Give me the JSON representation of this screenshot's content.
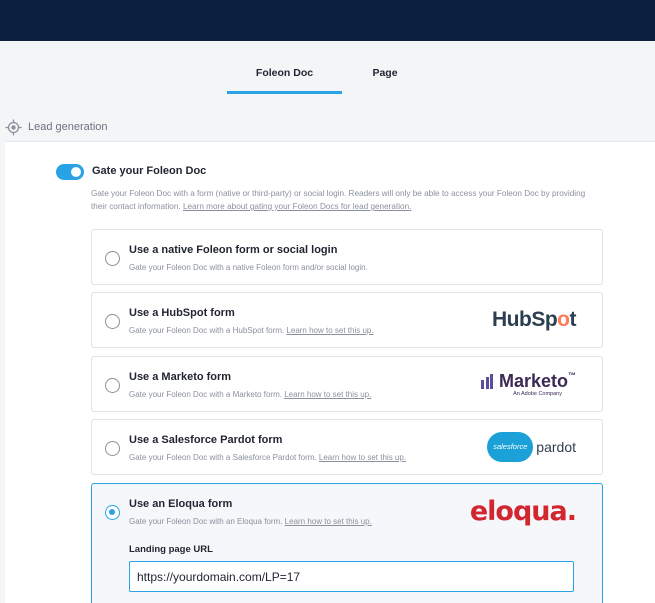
{
  "tabs": [
    {
      "label": "Foleon Doc",
      "active": true
    },
    {
      "label": "Page",
      "active": false
    }
  ],
  "section": {
    "title": "Lead generation",
    "icon": "target-icon"
  },
  "gate": {
    "toggle_on": true,
    "title": "Gate your Foleon Doc",
    "description": "Gate your Foleon Doc with a form (native or third-party) or social login. Readers will only be able to access your Foleon Doc by providing their contact information.",
    "learn_link": "Learn more about gating your Foleon Docs for lead generation."
  },
  "options": [
    {
      "title": "Use a native Foleon form or social login",
      "desc": "Gate your Foleon Doc with a native Foleon form and/or social login.",
      "link": "",
      "selected": false
    },
    {
      "title": "Use a HubSpot form",
      "desc": "Gate your Foleon Doc with a HubSpot form.",
      "link": "Learn how to set this up.",
      "selected": false,
      "logo": {
        "pre": "HubSp",
        "accent": "o",
        "post": "t"
      }
    },
    {
      "title": "Use a Marketo form",
      "desc": "Gate your Foleon Doc with a Marketo form.",
      "link": "Learn how to set this up.",
      "selected": false,
      "logo": {
        "name": "Marketo",
        "mark": "™",
        "sub": "An Adobe Company"
      }
    },
    {
      "title": "Use a Salesforce Pardot form",
      "desc": "Gate your Foleon Doc with a Salesforce Pardot form.",
      "link": "Learn how to set this up.",
      "selected": false,
      "logo": {
        "cloud": "salesforce",
        "name": "pardot"
      }
    },
    {
      "title": "Use an Eloqua form",
      "desc": "Gate your Foleon Doc with an Eloqua form.",
      "link": "Learn how to set this up.",
      "selected": true,
      "logo": {
        "name": "eloqua."
      }
    }
  ],
  "landing": {
    "label": "Landing page URL",
    "value": "https://yourdomain.com/LP=17"
  },
  "colors": {
    "accent": "#2aa3e6",
    "topbar": "#0c1f3f",
    "hubspot_orange": "#ff7a59",
    "eloqua_red": "#d22630"
  }
}
